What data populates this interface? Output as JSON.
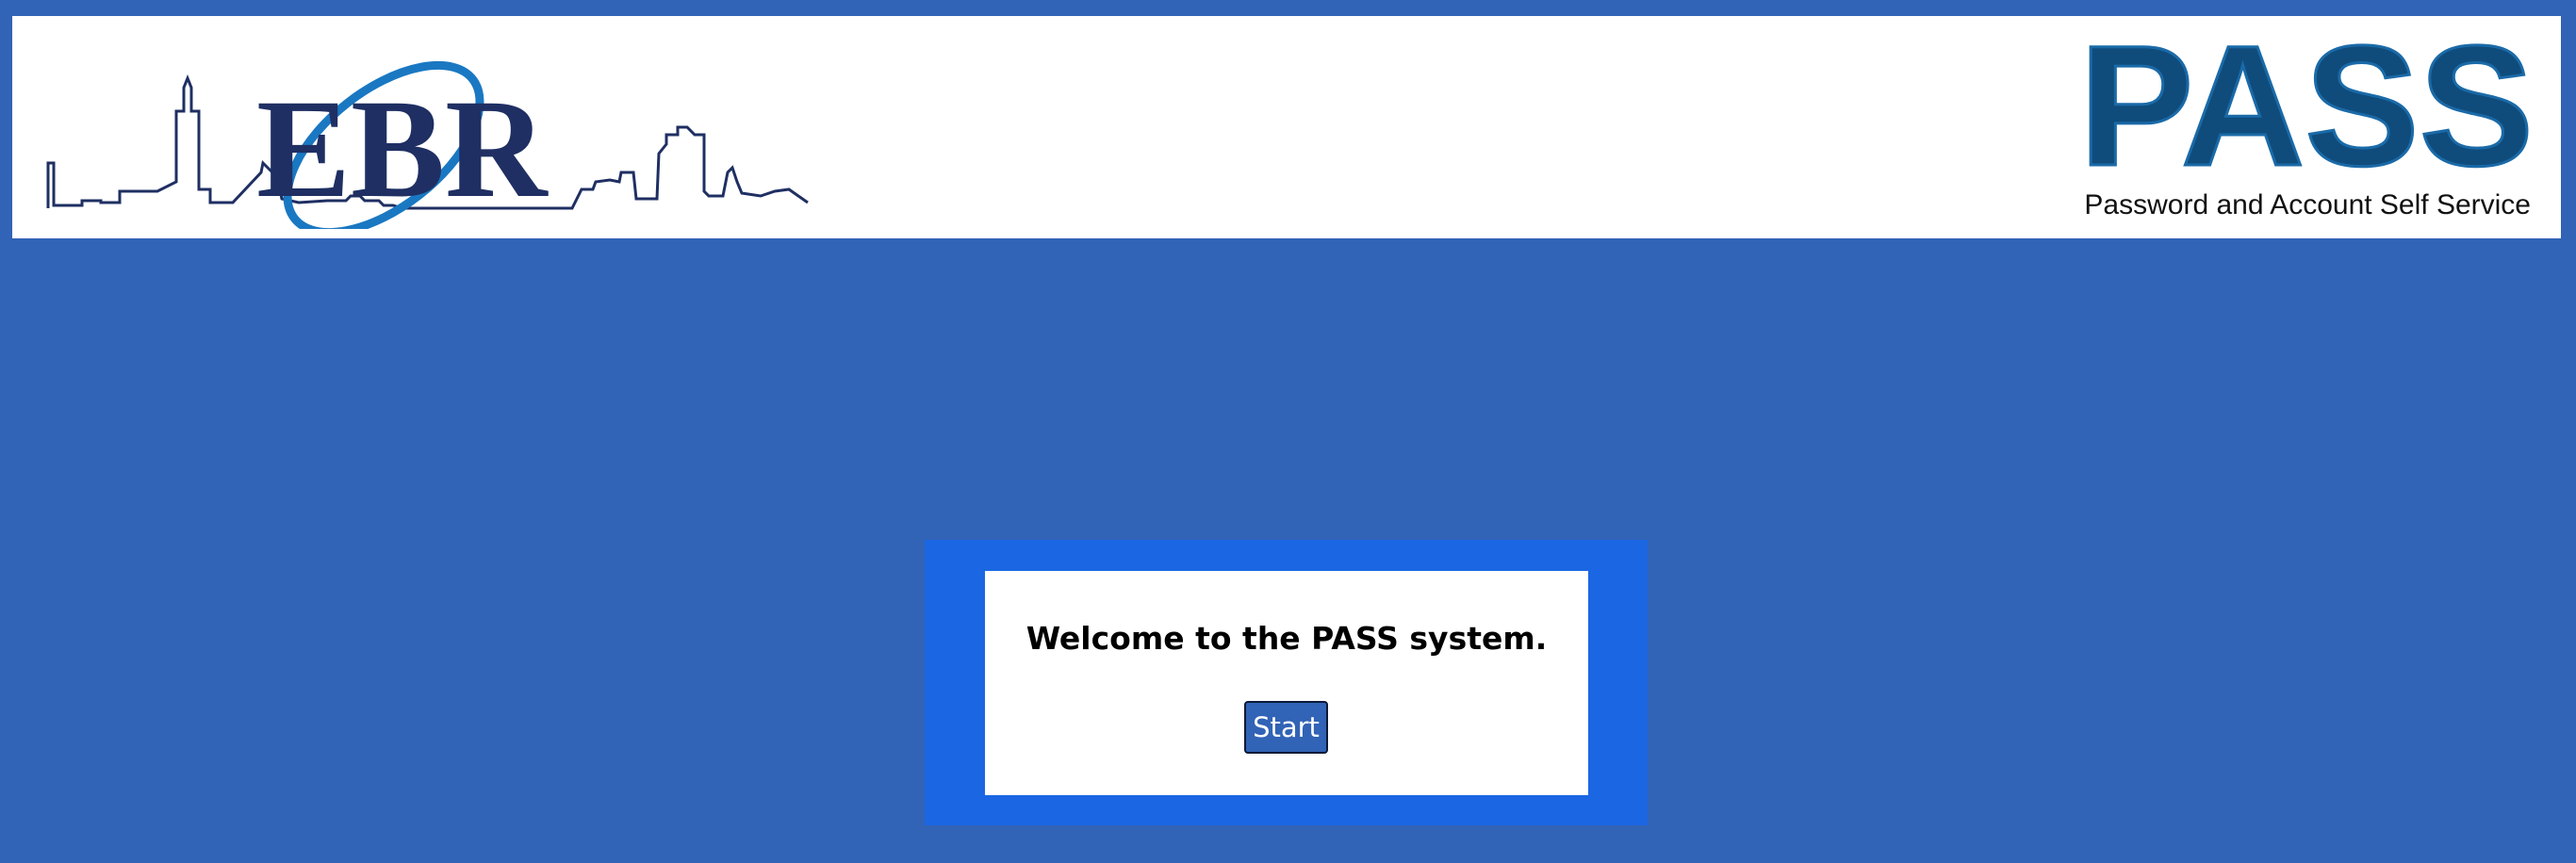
{
  "header": {
    "left_logo": {
      "text": "EBR",
      "icon": "city-skyline-icon"
    },
    "right_logo": {
      "text": "PASS",
      "tagline": "Password and Account Self Service"
    }
  },
  "welcome_panel": {
    "message": "Welcome to the PASS system.",
    "start_label": "Start"
  },
  "colors": {
    "page_background": "#3163b6",
    "panel_border": "#1b67e3",
    "logo_navy": "#1f2f63",
    "logo_blue": "#1a78c2",
    "pass_blue": "#0f4c7c"
  }
}
